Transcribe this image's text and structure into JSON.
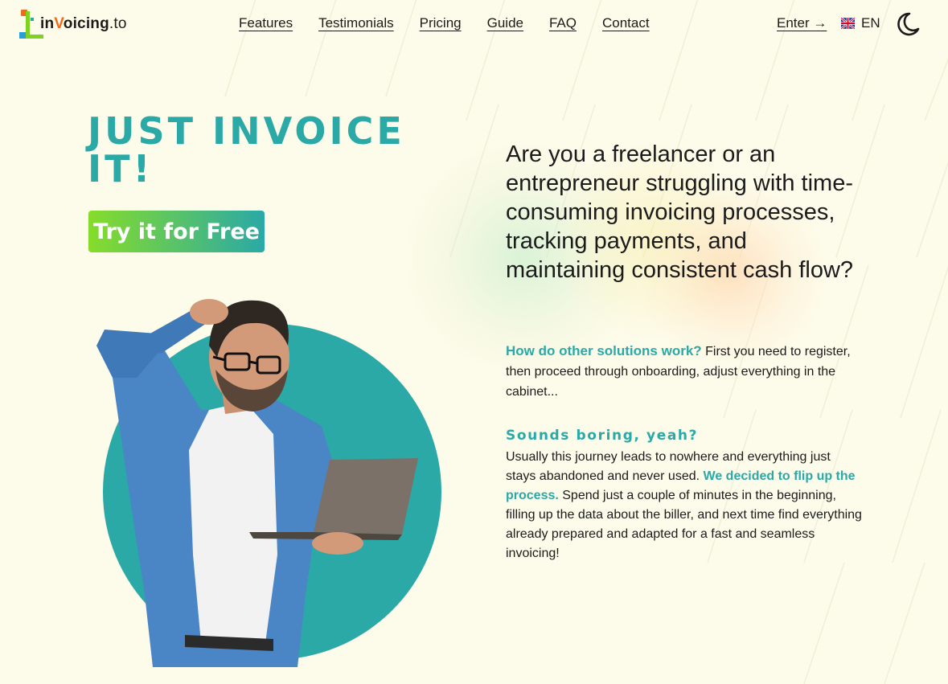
{
  "brand": {
    "logo_prefix": "in",
    "logo_v": "V",
    "logo_middle": "oicing",
    "logo_suffix": ".to",
    "colors": {
      "teal": "#2aa9a7",
      "lime": "#86dc2a",
      "orange": "#f26b1d",
      "blue": "#2a9fd6",
      "background": "#fdfbe9"
    }
  },
  "nav": {
    "items": [
      "Features",
      "Testimonials",
      "Pricing",
      "Guide",
      "FAQ",
      "Contact"
    ],
    "enter_label": "Enter →",
    "language": "EN",
    "language_icon": "uk-flag-icon",
    "theme_icon": "moon-icon"
  },
  "hero": {
    "title": "JUST INVOICE IT!",
    "cta_label": "Try it for Free",
    "image": "man-with-laptop-photo"
  },
  "intro": {
    "lead": "Are you a freelancer or an entrepreneur struggling with time-consuming invoicing processes, tracking payments, and maintaining consistent cash flow?",
    "question": "How do other solutions work?",
    "question_text": " First you need to register, then proceed through onboarding, adjust everything in the cabinet...",
    "subhead": "Sounds boring, yeah?",
    "body_start": "Usually this journey leads to nowhere and everything just stays abandoned and never used. ",
    "body_highlight": "We decided to flip up the process.",
    "body_end": " Spend just a couple of minutes in the beginning, filling up the data about the biller, and next time find everything already prepared and adapted for a fast and seamless invoicing!"
  }
}
